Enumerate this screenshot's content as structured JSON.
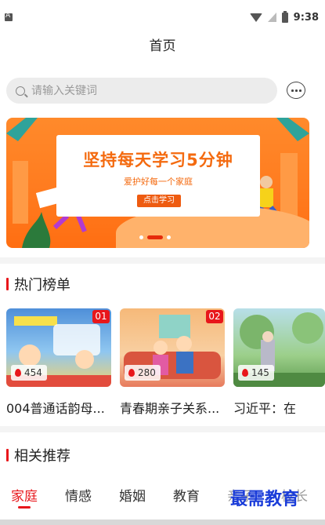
{
  "status_bar": {
    "time": "9:38"
  },
  "header": {
    "title": "首页"
  },
  "search": {
    "placeholder": "请输入关键词"
  },
  "banner": {
    "headline": "坚持每天学习5分钟",
    "subtitle": "爱护好每一个家庭",
    "cta": "点击学习",
    "slides": 3,
    "active_slide": 2
  },
  "hot": {
    "title": "热门榜单",
    "items": [
      {
        "rank": "01",
        "heat": "454",
        "title": "004普通话韵母..."
      },
      {
        "rank": "02",
        "heat": "280",
        "title": "青春期亲子关系..."
      },
      {
        "rank": "",
        "heat": "145",
        "title": "习近平：在"
      }
    ]
  },
  "recommend": {
    "title": "相关推荐",
    "tabs": [
      "家庭",
      "情感",
      "婚姻",
      "教育",
      "亲子",
      "校长"
    ],
    "active_tab": "家庭"
  },
  "watermark": "最需教育",
  "colors": {
    "accent": "#e8161b",
    "banner": "#ff7a1e"
  }
}
